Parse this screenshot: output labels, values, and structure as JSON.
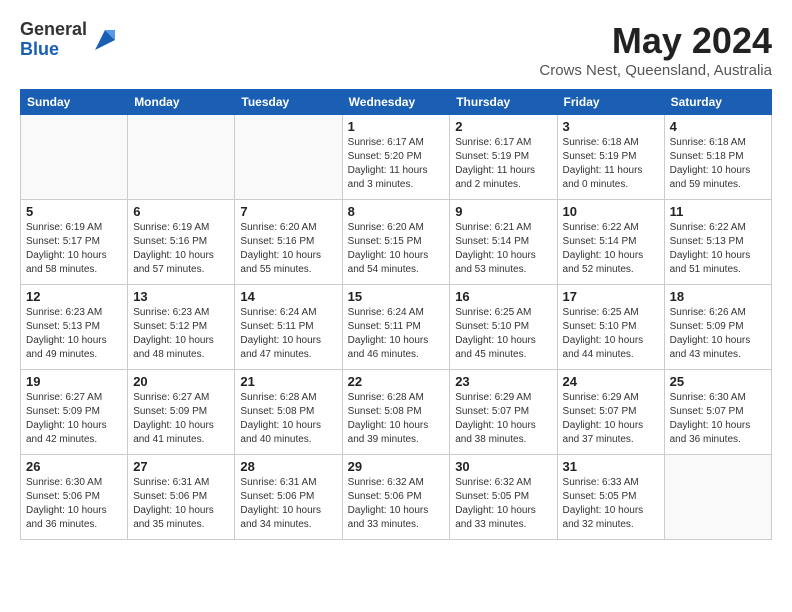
{
  "header": {
    "logo_general": "General",
    "logo_blue": "Blue",
    "month_year": "May 2024",
    "location": "Crows Nest, Queensland, Australia"
  },
  "weekdays": [
    "Sunday",
    "Monday",
    "Tuesday",
    "Wednesday",
    "Thursday",
    "Friday",
    "Saturday"
  ],
  "weeks": [
    [
      {
        "day": "",
        "info": ""
      },
      {
        "day": "",
        "info": ""
      },
      {
        "day": "",
        "info": ""
      },
      {
        "day": "1",
        "info": "Sunrise: 6:17 AM\nSunset: 5:20 PM\nDaylight: 11 hours and 3 minutes."
      },
      {
        "day": "2",
        "info": "Sunrise: 6:17 AM\nSunset: 5:19 PM\nDaylight: 11 hours and 2 minutes."
      },
      {
        "day": "3",
        "info": "Sunrise: 6:18 AM\nSunset: 5:19 PM\nDaylight: 11 hours and 0 minutes."
      },
      {
        "day": "4",
        "info": "Sunrise: 6:18 AM\nSunset: 5:18 PM\nDaylight: 10 hours and 59 minutes."
      }
    ],
    [
      {
        "day": "5",
        "info": "Sunrise: 6:19 AM\nSunset: 5:17 PM\nDaylight: 10 hours and 58 minutes."
      },
      {
        "day": "6",
        "info": "Sunrise: 6:19 AM\nSunset: 5:16 PM\nDaylight: 10 hours and 57 minutes."
      },
      {
        "day": "7",
        "info": "Sunrise: 6:20 AM\nSunset: 5:16 PM\nDaylight: 10 hours and 55 minutes."
      },
      {
        "day": "8",
        "info": "Sunrise: 6:20 AM\nSunset: 5:15 PM\nDaylight: 10 hours and 54 minutes."
      },
      {
        "day": "9",
        "info": "Sunrise: 6:21 AM\nSunset: 5:14 PM\nDaylight: 10 hours and 53 minutes."
      },
      {
        "day": "10",
        "info": "Sunrise: 6:22 AM\nSunset: 5:14 PM\nDaylight: 10 hours and 52 minutes."
      },
      {
        "day": "11",
        "info": "Sunrise: 6:22 AM\nSunset: 5:13 PM\nDaylight: 10 hours and 51 minutes."
      }
    ],
    [
      {
        "day": "12",
        "info": "Sunrise: 6:23 AM\nSunset: 5:13 PM\nDaylight: 10 hours and 49 minutes."
      },
      {
        "day": "13",
        "info": "Sunrise: 6:23 AM\nSunset: 5:12 PM\nDaylight: 10 hours and 48 minutes."
      },
      {
        "day": "14",
        "info": "Sunrise: 6:24 AM\nSunset: 5:11 PM\nDaylight: 10 hours and 47 minutes."
      },
      {
        "day": "15",
        "info": "Sunrise: 6:24 AM\nSunset: 5:11 PM\nDaylight: 10 hours and 46 minutes."
      },
      {
        "day": "16",
        "info": "Sunrise: 6:25 AM\nSunset: 5:10 PM\nDaylight: 10 hours and 45 minutes."
      },
      {
        "day": "17",
        "info": "Sunrise: 6:25 AM\nSunset: 5:10 PM\nDaylight: 10 hours and 44 minutes."
      },
      {
        "day": "18",
        "info": "Sunrise: 6:26 AM\nSunset: 5:09 PM\nDaylight: 10 hours and 43 minutes."
      }
    ],
    [
      {
        "day": "19",
        "info": "Sunrise: 6:27 AM\nSunset: 5:09 PM\nDaylight: 10 hours and 42 minutes."
      },
      {
        "day": "20",
        "info": "Sunrise: 6:27 AM\nSunset: 5:09 PM\nDaylight: 10 hours and 41 minutes."
      },
      {
        "day": "21",
        "info": "Sunrise: 6:28 AM\nSunset: 5:08 PM\nDaylight: 10 hours and 40 minutes."
      },
      {
        "day": "22",
        "info": "Sunrise: 6:28 AM\nSunset: 5:08 PM\nDaylight: 10 hours and 39 minutes."
      },
      {
        "day": "23",
        "info": "Sunrise: 6:29 AM\nSunset: 5:07 PM\nDaylight: 10 hours and 38 minutes."
      },
      {
        "day": "24",
        "info": "Sunrise: 6:29 AM\nSunset: 5:07 PM\nDaylight: 10 hours and 37 minutes."
      },
      {
        "day": "25",
        "info": "Sunrise: 6:30 AM\nSunset: 5:07 PM\nDaylight: 10 hours and 36 minutes."
      }
    ],
    [
      {
        "day": "26",
        "info": "Sunrise: 6:30 AM\nSunset: 5:06 PM\nDaylight: 10 hours and 36 minutes."
      },
      {
        "day": "27",
        "info": "Sunrise: 6:31 AM\nSunset: 5:06 PM\nDaylight: 10 hours and 35 minutes."
      },
      {
        "day": "28",
        "info": "Sunrise: 6:31 AM\nSunset: 5:06 PM\nDaylight: 10 hours and 34 minutes."
      },
      {
        "day": "29",
        "info": "Sunrise: 6:32 AM\nSunset: 5:06 PM\nDaylight: 10 hours and 33 minutes."
      },
      {
        "day": "30",
        "info": "Sunrise: 6:32 AM\nSunset: 5:05 PM\nDaylight: 10 hours and 33 minutes."
      },
      {
        "day": "31",
        "info": "Sunrise: 6:33 AM\nSunset: 5:05 PM\nDaylight: 10 hours and 32 minutes."
      },
      {
        "day": "",
        "info": ""
      }
    ]
  ]
}
